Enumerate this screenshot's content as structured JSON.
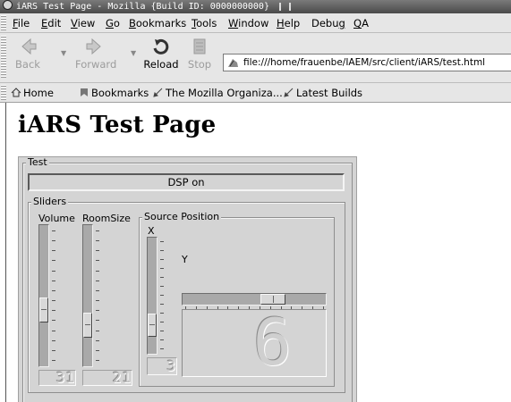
{
  "window": {
    "title": "iARS Test Page - Mozilla {Build ID: 0000000000}"
  },
  "menu": [
    "File",
    "Edit",
    "View",
    "Go",
    "Bookmarks",
    "Tools",
    "Window",
    "Help",
    "Debug",
    "QA"
  ],
  "menu_mnemonics": [
    "F",
    "E",
    "V",
    "G",
    "B",
    "T",
    "W",
    "H",
    "g",
    "Q"
  ],
  "navigation": {
    "back": "Back",
    "forward": "Forward",
    "reload": "Reload",
    "stop": "Stop",
    "url": "file:///home/frauenbe/IAEM/src/client/iARS/test.html"
  },
  "personal_toolbar": [
    "Home",
    "Bookmarks",
    "The Mozilla Organiza...",
    "Latest Builds"
  ],
  "page": {
    "title": "iARS Test Page",
    "test_legend": "Test",
    "dsp_button": "DSP on",
    "sliders_legend": "Sliders",
    "volume_label": "Volume",
    "roomsize_label": "RoomSize",
    "source_position_legend": "Source Position",
    "x_label": "X",
    "y_label": "Y",
    "volume_display": "31",
    "roomsize_display": "21",
    "x_display": "3",
    "y_display": "6"
  },
  "values": {
    "volume_thumb_fraction": 0.62,
    "roomsize_thumb_fraction": 0.75,
    "x_thumb_fraction": 0.82,
    "y_thumb_fraction": 0.66
  },
  "colors": {
    "chrome": "#e6e6e6",
    "panel": "#d4d4d4",
    "titlebar": "#5a5a5a"
  }
}
